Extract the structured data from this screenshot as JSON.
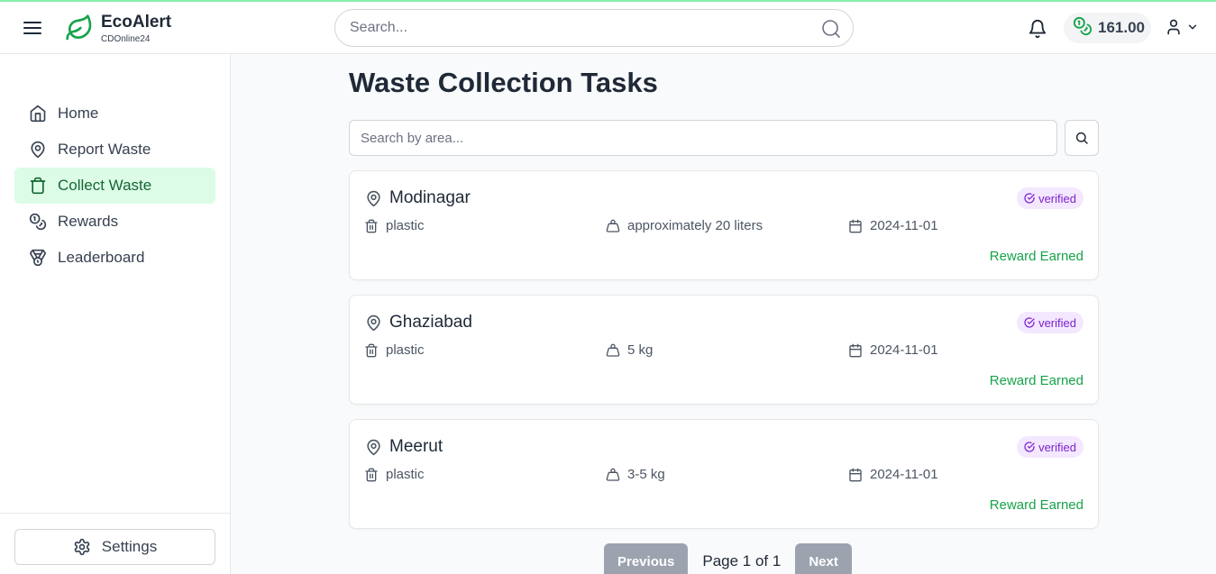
{
  "header": {
    "brand_name": "EcoAlert",
    "brand_sub": "CDOnline24",
    "search_placeholder": "Search...",
    "balance": "161.00"
  },
  "sidebar": {
    "items": [
      {
        "label": "Home",
        "icon": "home-icon",
        "active": false
      },
      {
        "label": "Report Waste",
        "icon": "map-pin-icon",
        "active": false
      },
      {
        "label": "Collect Waste",
        "icon": "trash-icon",
        "active": true
      },
      {
        "label": "Rewards",
        "icon": "coins-icon",
        "active": false
      },
      {
        "label": "Leaderboard",
        "icon": "medal-icon",
        "active": false
      }
    ],
    "settings_label": "Settings"
  },
  "main": {
    "title": "Waste Collection Tasks",
    "area_search_placeholder": "Search by area...",
    "tasks": [
      {
        "location": "Modinagar",
        "status": "verified",
        "type": "plastic",
        "amount": "approximately 20 liters",
        "date": "2024-11-01",
        "reward": "Reward Earned"
      },
      {
        "location": "Ghaziabad",
        "status": "verified",
        "type": "plastic",
        "amount": "5 kg",
        "date": "2024-11-01",
        "reward": "Reward Earned"
      },
      {
        "location": "Meerut",
        "status": "verified",
        "type": "plastic",
        "amount": "3-5 kg",
        "date": "2024-11-01",
        "reward": "Reward Earned"
      }
    ],
    "pagination": {
      "previous_label": "Previous",
      "info": "Page 1 of 1",
      "next_label": "Next"
    }
  },
  "colors": {
    "accent": "#16a34a",
    "active_bg": "#dcfce7",
    "badge_bg": "#f3e8ff",
    "badge_text": "#7e22ce"
  }
}
